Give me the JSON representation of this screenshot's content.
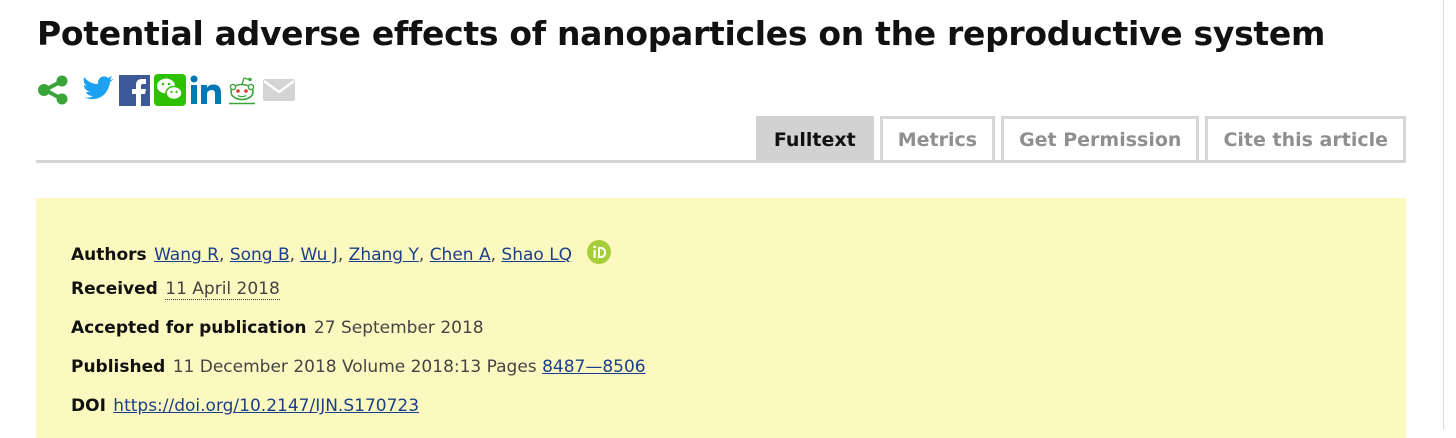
{
  "article": {
    "title": "Potential adverse effects of nanoparticles on the reproductive system"
  },
  "share_icons": [
    "share-icon",
    "twitter-icon",
    "facebook-icon",
    "wechat-icon",
    "linkedin-icon",
    "reddit-icon",
    "email-icon"
  ],
  "tabs": [
    {
      "label": "Fulltext",
      "active": true
    },
    {
      "label": "Metrics",
      "active": false
    },
    {
      "label": "Get Permission",
      "active": false
    },
    {
      "label": "Cite this article",
      "active": false
    }
  ],
  "meta": {
    "authors_label": "Authors",
    "authors": [
      "Wang R",
      "Song B",
      "Wu J",
      "Zhang Y",
      "Chen A",
      "Shao LQ"
    ],
    "received_label": "Received",
    "received": "11 April 2018",
    "accepted_label": "Accepted for publication",
    "accepted": "27 September 2018",
    "published_label": "Published",
    "published": "11 December 2018",
    "volume_text": "Volume 2018:13",
    "pages_label": "Pages",
    "pages": "8487—8506",
    "doi_label": "DOI",
    "doi": "https://doi.org/10.2147/IJN.S170723"
  },
  "colors": {
    "share_green": "#3aa33a",
    "twitter": "#1da1f2",
    "facebook": "#3b5998",
    "wechat": "#2dc100",
    "linkedin": "#0077b5",
    "orcid": "#a6ce39",
    "meta_bg": "#fcf9c0",
    "link": "#1b3f8b"
  }
}
